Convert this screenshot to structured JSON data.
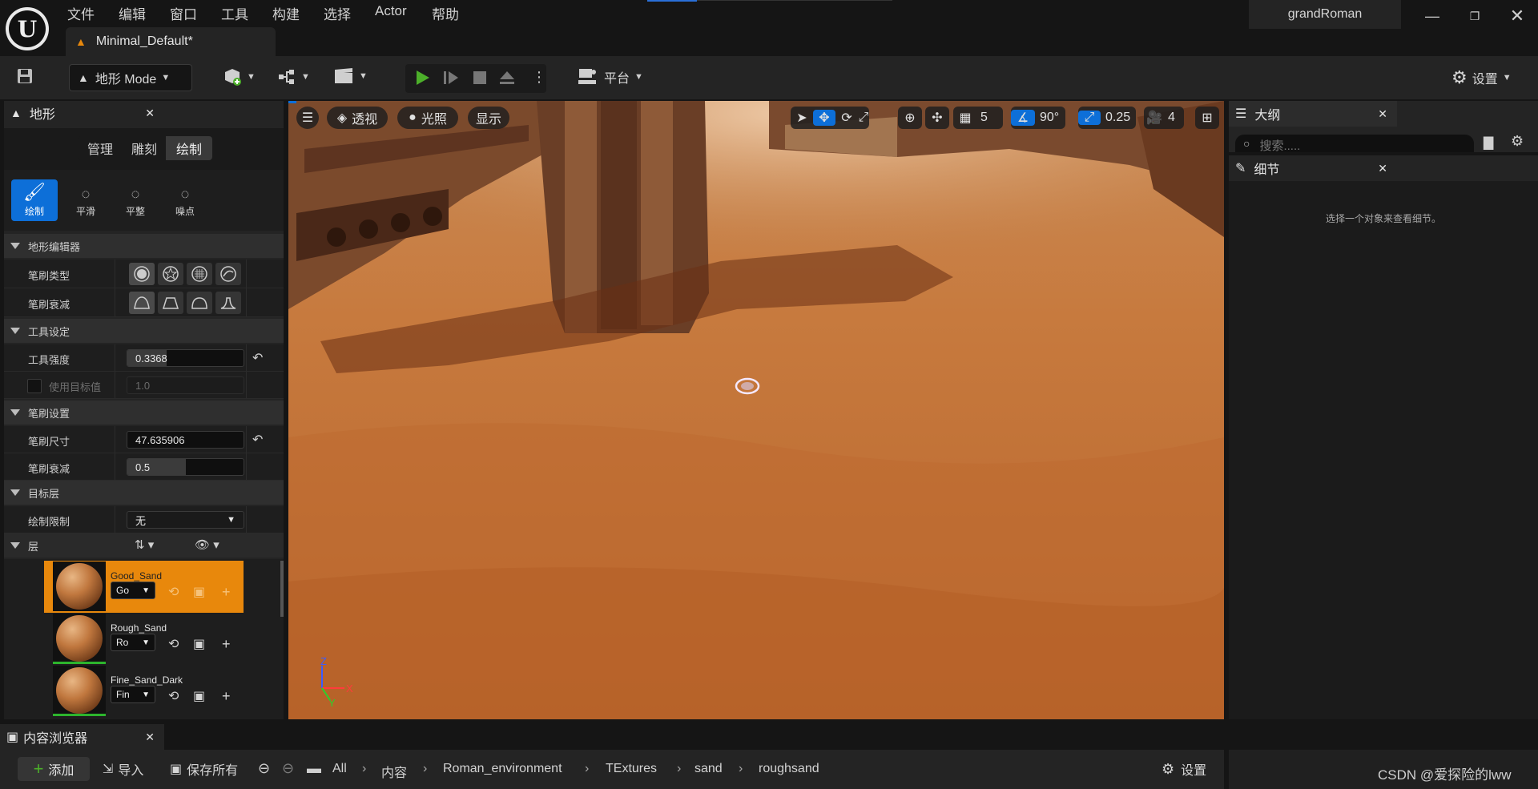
{
  "menu": [
    "文件",
    "编辑",
    "窗口",
    "工具",
    "构建",
    "选择",
    "Actor",
    "帮助"
  ],
  "doc_tab": {
    "title": "Minimal_Default*"
  },
  "project_name": "grandRoman",
  "toolbar": {
    "mode_label": "地形 Mode",
    "platform_label": "平台",
    "settings_label": "设置"
  },
  "landscape_panel": {
    "tab_title": "地形",
    "modes": [
      "管理",
      "雕刻",
      "绘制"
    ],
    "active_mode": "绘制",
    "tools": [
      "绘制",
      "平滑",
      "平整",
      "噪点"
    ],
    "active_tool": "绘制",
    "sections": {
      "editor": "地形编辑器",
      "tool_settings": "工具设定",
      "brush_settings": "笔刷设置",
      "target_layer": "目标层",
      "layers": "层"
    },
    "brush_type_label": "笔刷类型",
    "brush_falloff_label": "笔刷衰减",
    "tool_strength_label": "工具强度",
    "tool_strength_value": "0.3368",
    "use_target_label": "使用目标值",
    "use_target_value": "1.0",
    "brush_size_label": "笔刷尺寸",
    "brush_size_value": "47.635906",
    "brush_falloff2_label": "笔刷衰减",
    "brush_falloff2_value": "0.5",
    "paint_limit_label": "绘制限制",
    "paint_limit_value": "无",
    "layers": [
      {
        "name": "Good_Sand",
        "dropdown": "Go",
        "selected": true
      },
      {
        "name": "Rough_Sand",
        "dropdown": "Ro",
        "selected": false
      },
      {
        "name": "Fine_Sand_Dark",
        "dropdown": "Fin",
        "selected": false
      }
    ]
  },
  "viewport": {
    "perspective_label": "透视",
    "lighting_label": "光照",
    "show_label": "显示",
    "grid_value": "5",
    "rotation_value": "90°",
    "scale_value": "0.25",
    "camera_speed": "4",
    "axis": {
      "z": "Z",
      "x": "X",
      "y": "Y"
    }
  },
  "outliner": {
    "tab_title": "大纲",
    "search_placeholder": "搜索....."
  },
  "details": {
    "tab_title": "细节",
    "empty_message": "选择一个对象来查看细节。"
  },
  "content_browser": {
    "tab_title": "内容浏览器",
    "add_label": "添加",
    "import_label": "导入",
    "save_all_label": "保存所有",
    "breadcrumbs": [
      "All",
      "内容",
      "Roman_environment",
      "TExtures",
      "sand",
      "roughsand"
    ],
    "settings_label": "设置"
  },
  "watermark": "CSDN @爱探险的lww",
  "colors": {
    "accent": "#e8880c",
    "play": "#4caf2a",
    "selection_blue": "#0d6fd8"
  }
}
